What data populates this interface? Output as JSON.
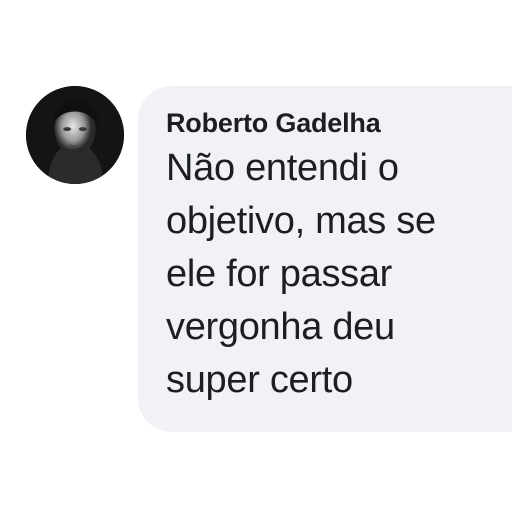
{
  "comment": {
    "author": "Roberto Gadelha",
    "text_lines": [
      "Não entendi o",
      "objetivo, mas se",
      "ele for passar",
      "vergonha deu",
      "super certo"
    ]
  },
  "colors": {
    "bubble_background": "#f0f2f5",
    "text": "#1c1e21",
    "page_background": "#ffffff"
  }
}
